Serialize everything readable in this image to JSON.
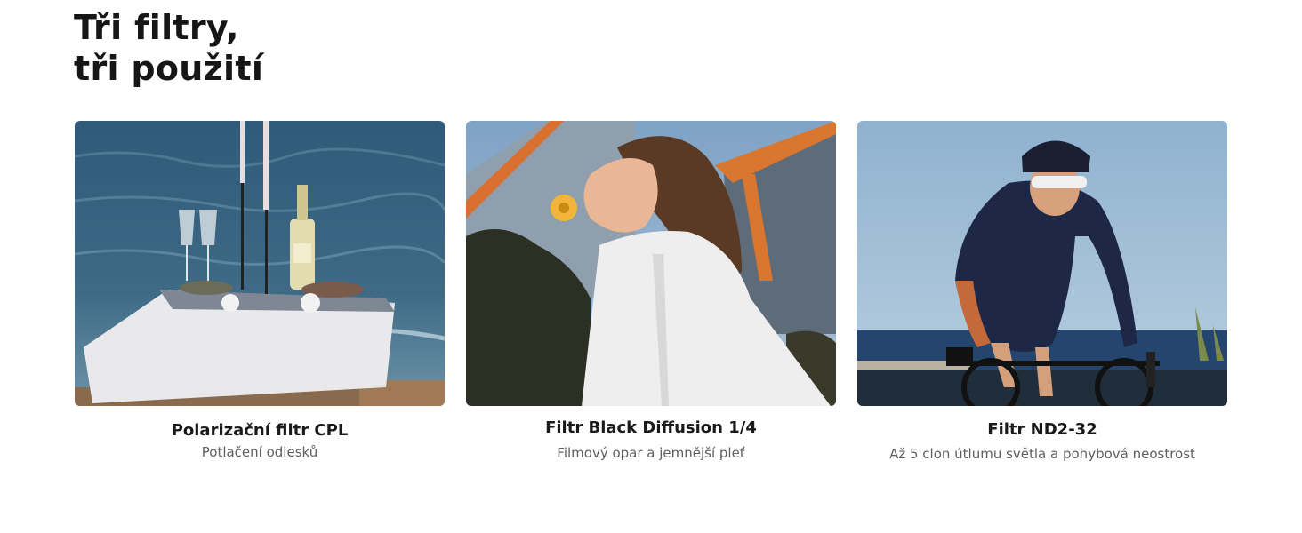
{
  "section": {
    "heading_line1": "Tři filtry,",
    "heading_line2": "tři použití"
  },
  "cards": [
    {
      "title": "Polarizační filtr CPL",
      "subtitle": "Potlačení odlesků",
      "image_subject": "seaside-picnic-table-photo"
    },
    {
      "title": "Filtr Black Diffusion 1/4",
      "subtitle": "Filmový opar a jemnější pleť",
      "image_subject": "woman-with-flower-portrait-photo"
    },
    {
      "title": "Filtr ND2-32",
      "subtitle": "Až 5 clon útlumu světla a pohybová neostrost",
      "image_subject": "cyclist-by-sea-photo"
    }
  ],
  "colors": {
    "heading": "#161616",
    "title": "#1a1a1a",
    "subtitle": "#5f5f5f",
    "background": "#ffffff"
  }
}
